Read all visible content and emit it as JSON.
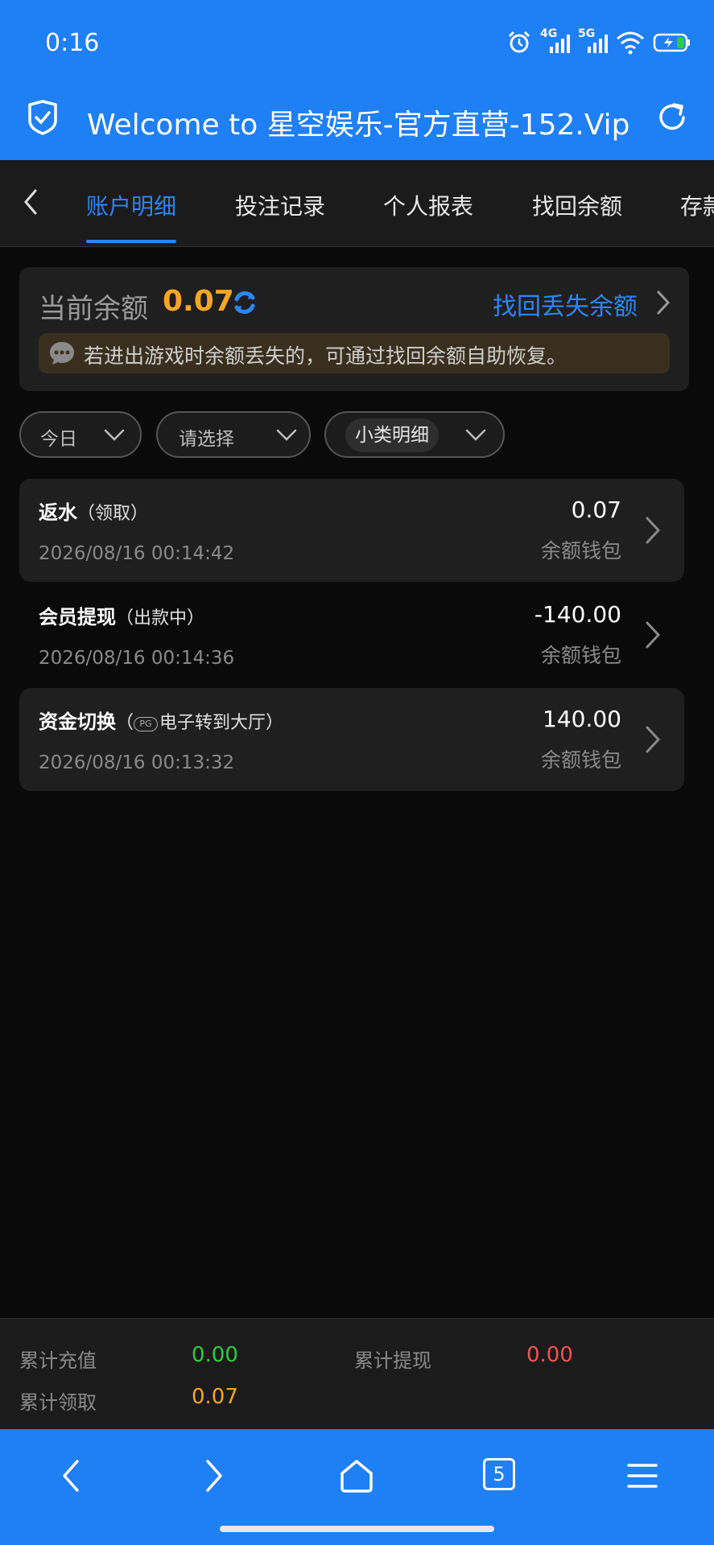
{
  "status_bar": {
    "time": "0:16",
    "net1": "4G",
    "net2": "5G"
  },
  "browser": {
    "title": "Welcome to 星空娱乐-官方直营-152.Vip"
  },
  "tabs": [
    {
      "label": "账户明细",
      "active": true
    },
    {
      "label": "投注记录"
    },
    {
      "label": "个人报表"
    },
    {
      "label": "找回余额"
    },
    {
      "label": "存款"
    }
  ],
  "balance": {
    "label": "当前余额",
    "value": "0.07",
    "recover_link": "找回丢失余额",
    "notice": "若进出游戏时余额丢失的，可通过找回余额自助恢复。"
  },
  "filters": {
    "date": "今日",
    "type": "请选择",
    "detail": "小类明细"
  },
  "records": [
    {
      "title": "返水",
      "sub": "（领取）",
      "time": "2026/08/16 00:14:42",
      "amount": "0.07",
      "wallet": "余额钱包"
    },
    {
      "title": "会员提现",
      "sub": "（出款中）",
      "time": "2026/08/16 00:14:36",
      "amount": "-140.00",
      "wallet": "余额钱包"
    },
    {
      "title": "资金切换",
      "sub_open": "（",
      "badge": "PG",
      "sub": "电子转到大厅）",
      "time": "2026/08/16 00:13:32",
      "amount": "140.00",
      "wallet": "余额钱包"
    }
  ],
  "summary": {
    "recharge_label": "累计充值",
    "recharge_value": "0.00",
    "withdraw_label": "累计提现",
    "withdraw_value": "0.00",
    "claim_label": "累计领取",
    "claim_value": "0.07"
  },
  "bottom_nav": {
    "tab_count": "5"
  },
  "colors": {
    "brand_blue": "#1f7ff5",
    "accent_orange": "#f5a623",
    "positive_green": "#2ecc40",
    "negative_red": "#ef5350"
  }
}
